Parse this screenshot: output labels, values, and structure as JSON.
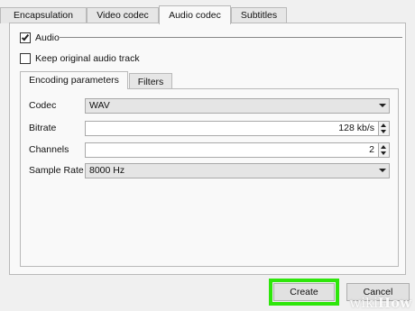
{
  "tabs": [
    "Encapsulation",
    "Video codec",
    "Audio codec",
    "Subtitles"
  ],
  "active_tab": "Audio codec",
  "audio": {
    "label": "Audio",
    "checked": true
  },
  "keep_original": {
    "label": "Keep original audio track",
    "checked": false
  },
  "inner_tabs": [
    "Encoding parameters",
    "Filters"
  ],
  "form": {
    "codec": {
      "label": "Codec",
      "value": "WAV"
    },
    "bitrate": {
      "label": "Bitrate",
      "value": "128 kb/s"
    },
    "channels": {
      "label": "Channels",
      "value": "2"
    },
    "sample_rate": {
      "label": "Sample Rate",
      "value": "8000 Hz"
    }
  },
  "buttons": {
    "create": "Create",
    "cancel": "Cancel"
  },
  "watermark": {
    "wiki": "wiki",
    "how": "How"
  },
  "colors": {
    "highlight": "#2ee60b"
  }
}
